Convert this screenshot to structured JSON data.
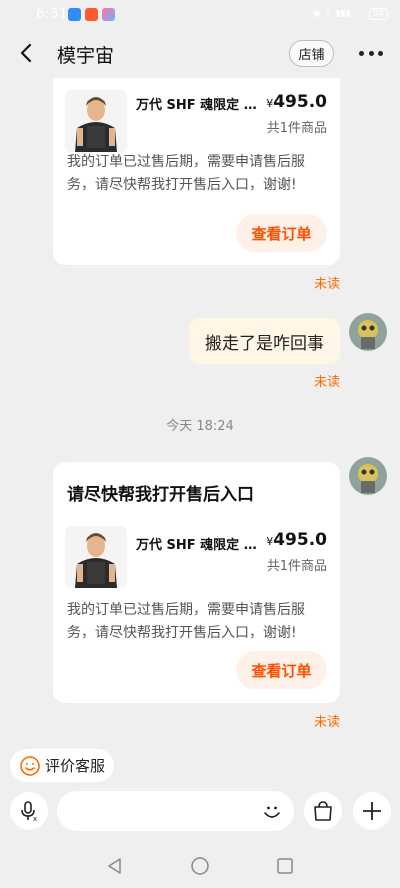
{
  "status_bar": {
    "time": "6:31",
    "battery": "94"
  },
  "header": {
    "title": "模宇宙",
    "store_label": "店铺"
  },
  "cards": [
    {
      "title": "",
      "product_name": "万代 SHF  魂限定 …",
      "price_symbol": "¥",
      "price": "495.0",
      "item_count": "共1件商品",
      "note": "我的订单已过售后期，需要申请售后服务，请尽快帮我打开售后入口，谢谢!",
      "button_label": "查看订单",
      "read_status": "未读"
    },
    {
      "title": "请尽快帮我打开售后入口",
      "product_name": "万代 SHF  魂限定 …",
      "price_symbol": "¥",
      "price": "495.0",
      "item_count": "共1件商品",
      "note": "我的订单已过售后期，需要申请售后服务，请尽快帮我打开售后入口，谢谢!",
      "button_label": "查看订单",
      "read_status": "未读"
    }
  ],
  "text_message": {
    "text": "搬走了是咋回事",
    "read_status": "未读"
  },
  "timestamp": "今天  18:24",
  "rate_service": {
    "label": "评价客服"
  },
  "input": {
    "placeholder": ""
  },
  "colors": {
    "accent": "#ff5000",
    "unread": "#ff6a00",
    "bubble": "#fff6e6",
    "background": "#efefef"
  }
}
